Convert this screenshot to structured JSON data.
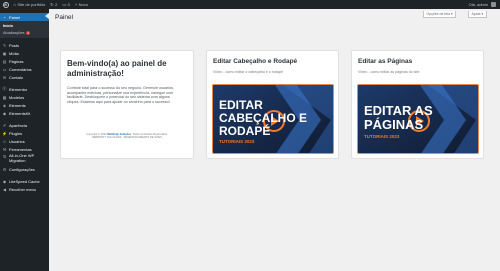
{
  "adminbar": {
    "site_name": "Site de portfólio",
    "updates_count": "2",
    "comments_count": "0",
    "new_label": "Novo",
    "greeting": "Olá, admin"
  },
  "sidebar": {
    "active": "Painel",
    "sub": {
      "home": "Início",
      "updates": "Atualizações",
      "updates_badge": "2"
    },
    "items": [
      {
        "label": "Posts",
        "icon": "pin-icon"
      },
      {
        "label": "Mídia",
        "icon": "media-icon"
      },
      {
        "label": "Páginas",
        "icon": "page-icon"
      },
      {
        "label": "Comentários",
        "icon": "comment-icon"
      },
      {
        "label": "Contato",
        "icon": "mail-icon"
      },
      {
        "label": "Elementor",
        "icon": "elementor-icon"
      },
      {
        "label": "Modelos",
        "icon": "folder-icon"
      },
      {
        "label": "Elements",
        "icon": "elements-icon"
      },
      {
        "label": "ElementsKit",
        "icon": "kit-icon"
      },
      {
        "label": "Aparência",
        "icon": "brush-icon"
      },
      {
        "label": "Plugins",
        "icon": "plugin-icon"
      },
      {
        "label": "Usuários",
        "icon": "user-icon"
      },
      {
        "label": "Ferramentas",
        "icon": "wrench-icon"
      },
      {
        "label": "All-in-One WP Migration",
        "icon": "migration-icon"
      },
      {
        "label": "Configurações",
        "icon": "settings-icon"
      },
      {
        "label": "LiteSpeed Cache",
        "icon": "litespeed-icon"
      },
      {
        "label": "Recolher menu",
        "icon": "collapse-icon"
      }
    ]
  },
  "header": {
    "title": "Painel",
    "screen_options": "Opções de tela",
    "help": "Ajuda"
  },
  "welcome": {
    "title": "Bem-vindo(a) ao painel de administração!",
    "text": "Controle total para o sucesso do seu negócio. Gerencie usuários, acompanhe métricas, personalize sua experiência, navegue com facilidade. Desbloqueie o potencial do seu sistema com alguns cliques. Estamos aqui para ajudar no caminho para o sucesso!",
    "copyright_prefix": "Copyright © 2023",
    "copyright_brand": "Webfinity Soluções",
    "copyright_suffix": ". Todos os Direitos Reservados.",
    "copyright_line2": "WEBFINITY SOLUÇÕES · DESENVOLVIMENTO DE SITES"
  },
  "videos": [
    {
      "title": "Editar Cabeçalho e Rodapé",
      "subtitle": "Vídeo - como editar o cabeçalho e o rodapé",
      "thumb_line1": "EDITAR",
      "thumb_line2": "CABEÇALHO E",
      "thumb_line3": "RODAPÉ",
      "thumb_tag": "TUTORIAIS 2023"
    },
    {
      "title": "Editar as Páginas",
      "subtitle": "Vídeo - como editar as páginas do site",
      "thumb_line1": "EDITAR AS",
      "thumb_line2": "PÁGINAS",
      "thumb_tag": "TUTORIAIS 2023"
    }
  ],
  "colors": {
    "accent": "#2271b1",
    "adminbar": "#1d2327",
    "thumb_bg": "#16223a",
    "thumb_border": "#e9874a",
    "badge": "#d63638"
  }
}
